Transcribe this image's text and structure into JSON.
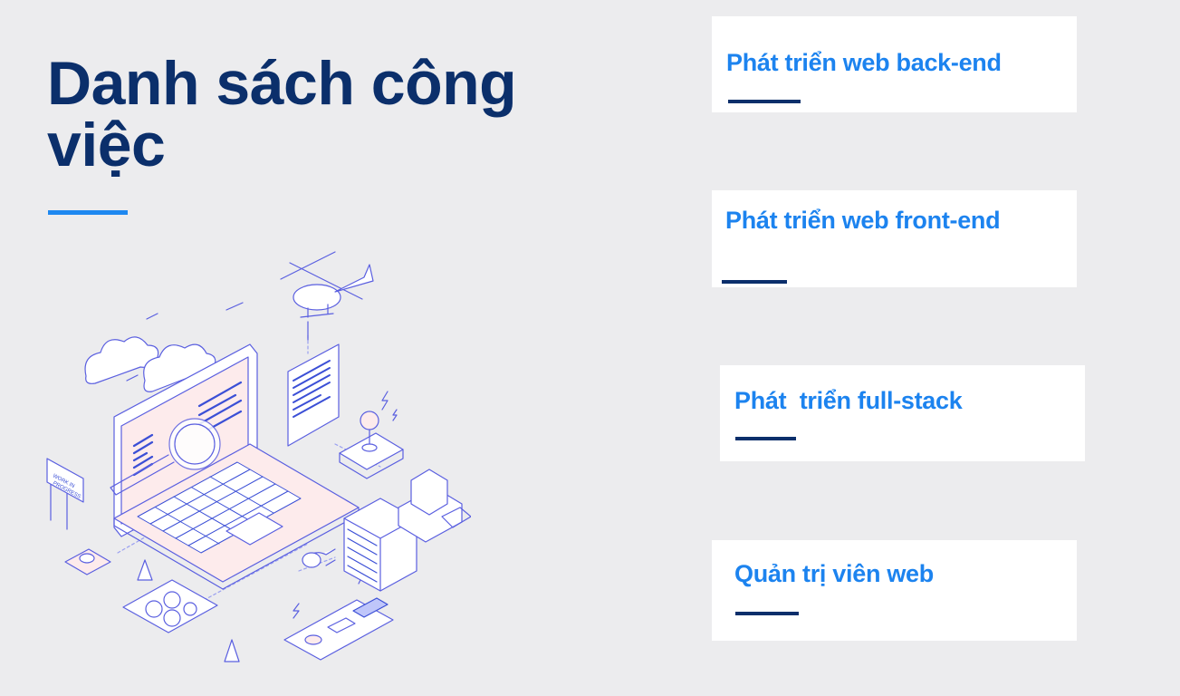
{
  "heading": {
    "title": "Danh sách công việc"
  },
  "illustration": {
    "sign_text": "WORK IN PROGRESS"
  },
  "jobs": [
    {
      "label": "Phát triển web back-end"
    },
    {
      "label": "Phát triển web front-end"
    },
    {
      "label": "Phát  triển full-stack"
    },
    {
      "label": "Quản trị viên web"
    }
  ],
  "colors": {
    "background": "#ECECEE",
    "title": "#0B2F6B",
    "accent": "#1E88F0",
    "card_label": "#1C83EF",
    "card_bar": "#0B2F6B"
  }
}
